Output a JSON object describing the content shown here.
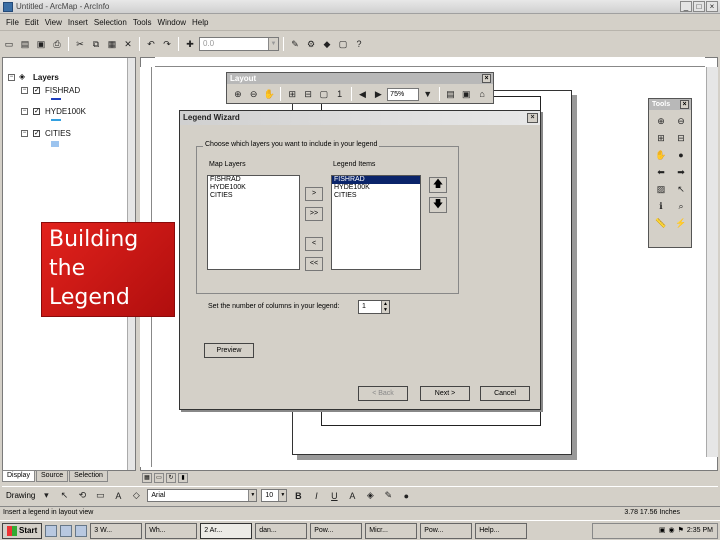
{
  "window": {
    "title": "Untitled - ArcMap - ArcInfo"
  },
  "menu": [
    "File",
    "Edit",
    "View",
    "Insert",
    "Selection",
    "Tools",
    "Window",
    "Help"
  ],
  "standard_toolbar": {
    "scale_value": "0.0"
  },
  "toc": {
    "root_label": "Layers",
    "layers": [
      {
        "name": "FISHRAD",
        "symbol_color": "#1f3fbf"
      },
      {
        "name": "HYDE100K",
        "symbol_color": "#33a0e0"
      },
      {
        "name": "CITIES",
        "symbol_color": "#9cc4ef"
      }
    ],
    "tabs": [
      "Display",
      "Source",
      "Selection"
    ]
  },
  "layout_toolbar": {
    "title": "Layout",
    "zoom_value": "75%"
  },
  "tools_toolbar": {
    "title": "Tools"
  },
  "overlay": {
    "line1": "Building",
    "line2": "the",
    "line3": "Legend",
    "bg_color": "#d41a17"
  },
  "legend_wizard": {
    "title": "Legend Wizard",
    "group_label": "Choose which layers you want to include in your legend",
    "map_layers_label": "Map Layers",
    "legend_items_label": "Legend Items",
    "map_layers": [
      "FISHRAD",
      "HYDE100K",
      "CITIES"
    ],
    "legend_items": [
      "FISHRAD",
      "HYDE100K",
      "CITIES"
    ],
    "selected_legend_item": "FISHRAD",
    "btn_add": ">",
    "btn_add_all": ">>",
    "btn_remove": "<",
    "btn_remove_all": "<<",
    "columns_label": "Set the number of columns in your legend:",
    "columns_value": "1",
    "preview_label": "Preview",
    "back_label": "< Back",
    "next_label": "Next >",
    "cancel_label": "Cancel"
  },
  "draw_toolbar": {
    "drawing_label": "Drawing",
    "font_name": "Arial",
    "font_size": "10"
  },
  "status": {
    "left": "Insert a legend in layout view",
    "right": "3.78 17.56 Inches"
  },
  "taskbar": {
    "start_label": "Start",
    "tasks": [
      "3 W...",
      "Wh...",
      "2 Ar...",
      "dan...",
      "Pow...",
      "Micr...",
      "Pow...",
      "Help..."
    ],
    "clock": "2:35 PM"
  }
}
